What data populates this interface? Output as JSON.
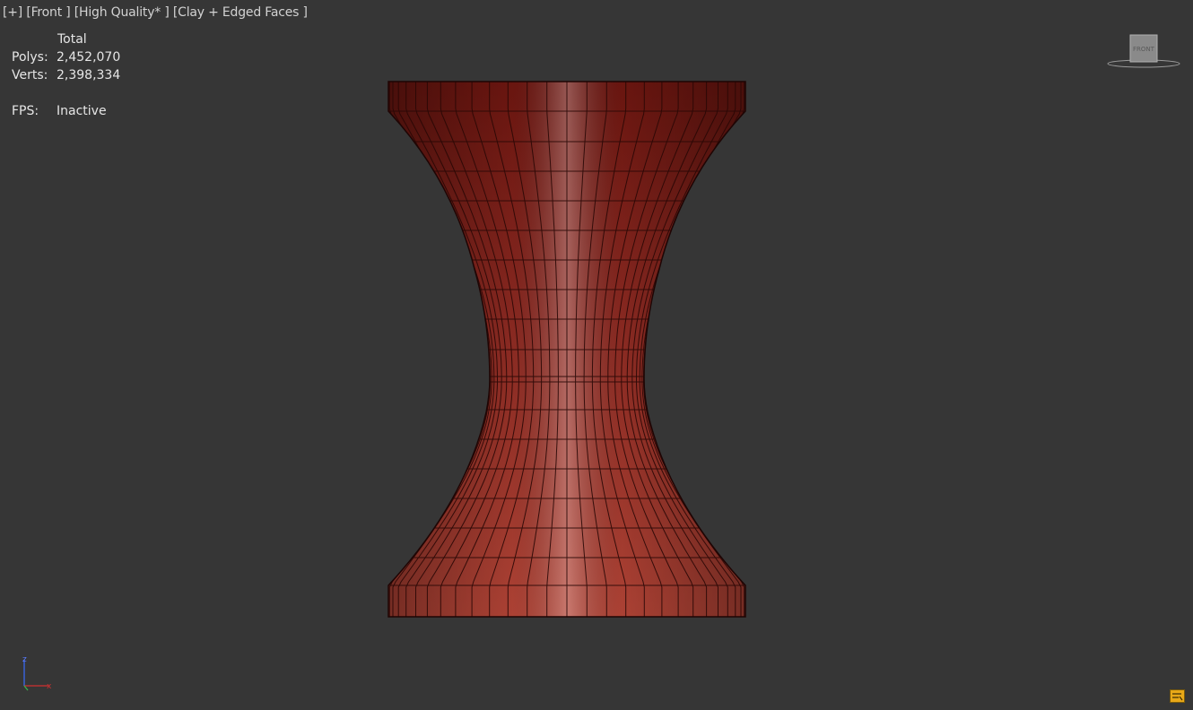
{
  "viewport": {
    "label_plus": "[+]",
    "label_view": "[Front ]",
    "label_quality": "[High Quality* ]",
    "label_shading": "[Clay + Edged Faces ]"
  },
  "stats": {
    "header": "Total",
    "polys_label": "Polys:",
    "polys_value": "2,452,070",
    "verts_label": "Verts:",
    "verts_value": "2,398,334",
    "fps_label": "FPS:",
    "fps_value": "Inactive"
  },
  "viewcube": {
    "face_label": "FRONT"
  },
  "axis_gizmo": {
    "z": "z",
    "x": "x"
  },
  "colors": {
    "background": "#363636",
    "model_top": "#7a1a14",
    "model_bottom": "#b8473a",
    "wire": "#2a0806"
  },
  "icons": {
    "viewcube": "viewcube-icon",
    "axis": "axis-tripod-icon",
    "corner": "viewport-config-icon"
  }
}
